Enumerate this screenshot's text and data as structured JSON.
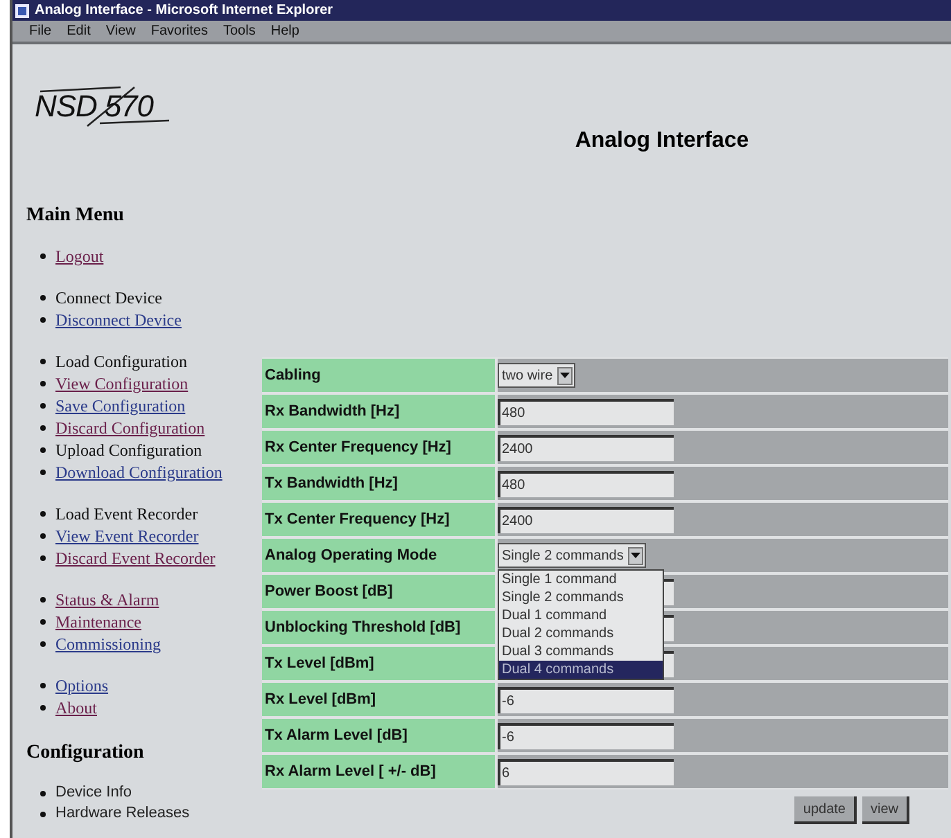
{
  "window": {
    "title": "Analog Interface - Microsoft Internet Explorer"
  },
  "menu_bar": [
    "File",
    "Edit",
    "View",
    "Favorites",
    "Tools",
    "Help"
  ],
  "logo": {
    "text": "NSD 570"
  },
  "page_title": "Analog Interface",
  "main_menu": {
    "title": "Main Menu",
    "groups": [
      [
        {
          "label": "Logout",
          "kind": "visited_link"
        }
      ],
      [
        {
          "label": "Connect Device",
          "kind": "text"
        },
        {
          "label": "Disconnect Device",
          "kind": "link"
        }
      ],
      [
        {
          "label": "Load Configuration",
          "kind": "text"
        },
        {
          "label": "View Configuration",
          "kind": "visited_link"
        },
        {
          "label": "Save Configuration",
          "kind": "link"
        },
        {
          "label": "Discard Configuration",
          "kind": "visited_link"
        },
        {
          "label": "Upload Configuration",
          "kind": "text"
        },
        {
          "label": "Download Configuration",
          "kind": "link"
        }
      ],
      [
        {
          "label": "Load Event Recorder",
          "kind": "text"
        },
        {
          "label": "View Event Recorder",
          "kind": "link"
        },
        {
          "label": "Discard Event Recorder",
          "kind": "visited_link"
        }
      ],
      [
        {
          "label": "Status & Alarm",
          "kind": "visited_link"
        },
        {
          "label": "Maintenance",
          "kind": "visited_link"
        },
        {
          "label": "Commissioning",
          "kind": "link"
        }
      ],
      [
        {
          "label": "Options",
          "kind": "link"
        },
        {
          "label": "About",
          "kind": "visited_link"
        }
      ]
    ]
  },
  "configuration": {
    "title": "Configuration",
    "items": [
      "Device Info",
      "Hardware Releases"
    ]
  },
  "form": {
    "rows": [
      {
        "label": "Cabling",
        "kind": "select",
        "value": "two wire"
      },
      {
        "label": "Rx Bandwidth [Hz]",
        "kind": "input",
        "value": "480"
      },
      {
        "label": "Rx Center Frequency [Hz]",
        "kind": "input",
        "value": "2400"
      },
      {
        "label": "Tx Bandwidth [Hz]",
        "kind": "input",
        "value": "480"
      },
      {
        "label": "Tx Center Frequency [Hz]",
        "kind": "input",
        "value": "2400"
      },
      {
        "label": "Analog Operating Mode",
        "kind": "select",
        "value": "Single 2 commands",
        "expanded": true,
        "options": [
          {
            "label": "Single 1 command",
            "highlighted": false
          },
          {
            "label": "Single 2 commands",
            "highlighted": false
          },
          {
            "label": "Dual 1 command",
            "highlighted": false
          },
          {
            "label": "Dual 2 commands",
            "highlighted": false
          },
          {
            "label": "Dual 3 commands",
            "highlighted": false
          },
          {
            "label": "Dual 4 commands",
            "highlighted": true
          }
        ]
      },
      {
        "label": "Power Boost [dB]",
        "kind": "input"
      },
      {
        "label": "Unblocking Threshold [dB]",
        "kind": "input"
      },
      {
        "label": "Tx Level [dBm]",
        "kind": "input"
      },
      {
        "label": "Rx Level [dBm]",
        "kind": "input",
        "value": "-6"
      },
      {
        "label": "Tx Alarm Level [dB]",
        "kind": "input",
        "value": "-6"
      },
      {
        "label": "Rx Alarm Level [ +/- dB]",
        "kind": "input",
        "value": "6"
      }
    ],
    "buttons": [
      "update",
      "view"
    ]
  }
}
